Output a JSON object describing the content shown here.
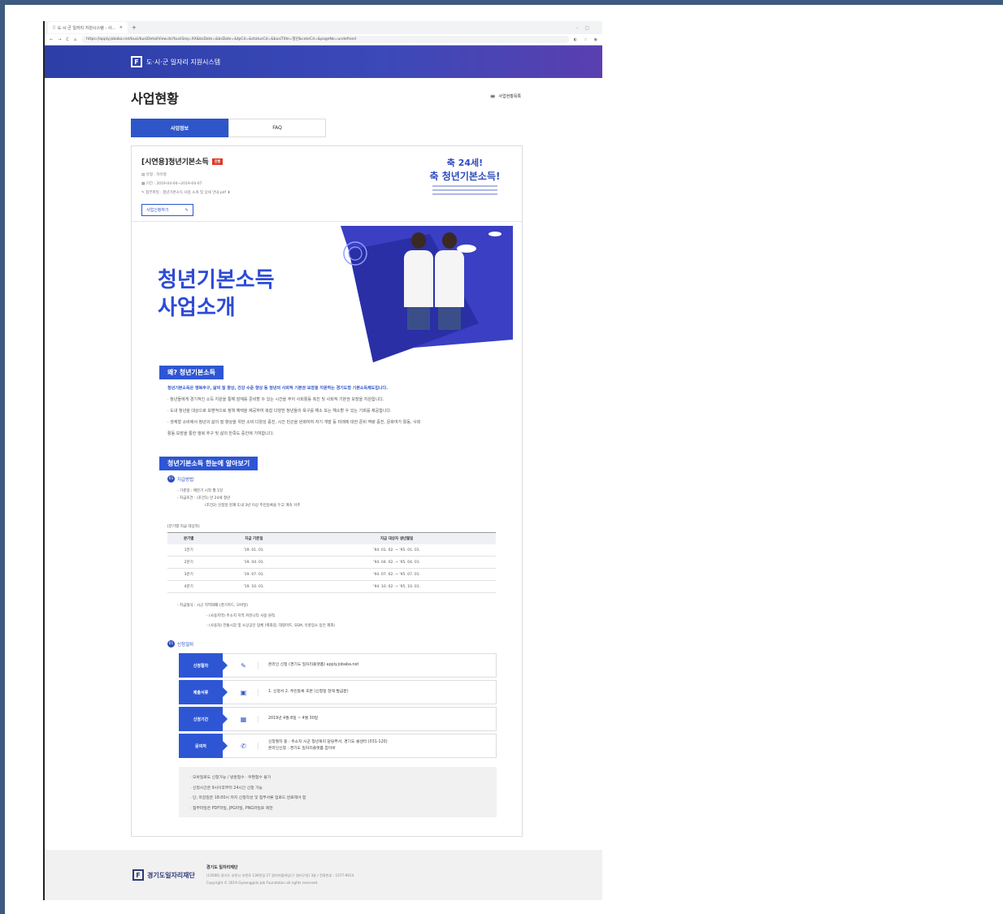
{
  "browser": {
    "tab_title": "도·시·군 일자리 지원시스템 - 사...",
    "url": "https://apply.jobaba.net/busi/busiDetailView.do?busiSeq=XX&bsDate=&bsDate=&tpCd=&statusCd=&busiTitle=청년&cateCd=&pageNo=undefined"
  },
  "site": {
    "name": "도·시·군 일자리 지원시스템"
  },
  "page": {
    "title": "사업현황",
    "list_link": "사업현황목록",
    "tabs": [
      "사업정보",
      "FAQ"
    ]
  },
  "program": {
    "title": "[시연용]청년기본소득",
    "badge": "진행",
    "type": "유형 : 자유형",
    "period": "기간 : 2019-04-04~2019-04-07",
    "attachment": "첨부파일 : 청년기본소득 사업 소개 및 상세 안내.pdf",
    "apply_button": "사업신청하기"
  },
  "thumb": {
    "line1": "축 24세!",
    "line2": "축 청년기본소득!"
  },
  "hero": {
    "line1": "청년기본소득",
    "line2": "사업소개"
  },
  "why": {
    "tag": "왜? 청년기본소득",
    "lead": "청년기본소득은 행복추구, 삶의 질 향상, 건강 수준 향상 등 청년의 사회적 기본권 보장을 지원하는 경기도형 기본소득제도입니다.",
    "b1": "· 청년들에게 경기적인 소득 지원을 통해 잠재를 준비할 수 있는 시간을 주어 사회활동 촉진 및 사회적 기본권 보장을 지원합니다.",
    "b2": "· 도내 청년을 대상으로 보편적으로 정책 혜택을 제공하여 복잡 다양한 청년들의 욕구를 해소 또는 해소할 수 있는 기회를 제공합니다.",
    "b3": "· 생계형 소비에서 청년의 삶의 질 향상을 위한 소비 다양성 증진, 시간 빈곤을 완화하여 자기 개발 등 미래에 대한 준비 역량 증진, 문화여가 활동, 사회",
    "b3b": "활동 보장을 통한 행복 추구 및 삶의 만족도 증진에 기여합니다."
  },
  "overview": {
    "tag": "청년기본소득 한눈에 알아보기",
    "pay_method": {
      "num": "01",
      "label": "지급방법"
    },
    "basis": "- 기준일 : 매분기 시작 월 1일",
    "cond1": "- 지급조건 : (조건1) 만 24세 청년",
    "cond2": "(조건2) 신청일 현재 도내 3년 이상 주민등록을 두고 계속 거주",
    "table_caption": "[분기별 지급 대상자]",
    "table_headers": [
      "분기별",
      "지급 기준일",
      "지급 대상자 생년월일"
    ],
    "table_rows": [
      [
        "1분기",
        "'19. 01. 01.",
        "'94. 01. 02. ~ '95. 01. 01."
      ],
      [
        "2분기",
        "'19. 04. 01.",
        "'94. 04. 02. ~ '95. 04. 01."
      ],
      [
        "3분기",
        "'19. 07. 01.",
        "'94. 07. 02. ~ '95. 07. 01."
      ],
      [
        "4분기",
        "'19. 10. 01.",
        "'94. 10. 02. ~ '95. 10. 01."
      ]
    ],
    "form1": "- 지급형식 : 시군 지역화폐 (경기카드, 모바일)",
    "form2": "- (사용지역) 주소지 지역 커뮤니티 사용 원칙",
    "form3": "- (사용처) 전통시장 및 소상공인 업체 (백화점, 대형마트, SSM, 유흥업소 등은 제외)",
    "apply_proc": {
      "num": "01",
      "label": "신청절차"
    }
  },
  "steps": [
    {
      "label": "신청절차",
      "icon": "pencil-icon",
      "text1": "온라인 신청 (경기도 일자리플랫폼) apply.jobaba.net",
      "text2": ""
    },
    {
      "label": "제출서류",
      "icon": "clipboard-icon",
      "text1": "1. 신청서  2. 주민등록 초본 (신청일 현재 발급분)",
      "text2": ""
    },
    {
      "label": "신청기간",
      "icon": "calendar-icon",
      "text1": "2019년 4월 8일 ~ 4월 30일",
      "text2": ""
    },
    {
      "label": "문의처",
      "icon": "phone-icon",
      "text1": "신청절차 등 : 주소지 시군 청년복지 담당부서, 경기도 콜센터 (031-120)",
      "text2": "온라인신청 : 경기도 일자리플랫폼 잡아바"
    }
  ],
  "notes": [
    "· 모바일로도 신청가능 / 방문접수 · 우편접수 불가",
    "· 신청시간은 9시이후부터 24시간 신청 가능",
    "· 단, 마감일은 18:00시 까지 신청작성 및 첨부서류 업로드 완료해야 함",
    "· 첨부파일은 PDF파일, JPG파일, PNG파일로 제한"
  ],
  "footer": {
    "logo": "경기도일자리재단",
    "org": "경기도 일자리재단",
    "address": "(14566) 경기도 부천시 부천로 136번길 27 원미어울마당(구 원미구청) 3층 / 전화번호 : 1577-9014",
    "copyright": "Copyright © 2019 Gyeonggido Job Foundation all rights reserved."
  },
  "colors": {
    "accent": "#2e56d4",
    "header": "#2c3ea8"
  }
}
